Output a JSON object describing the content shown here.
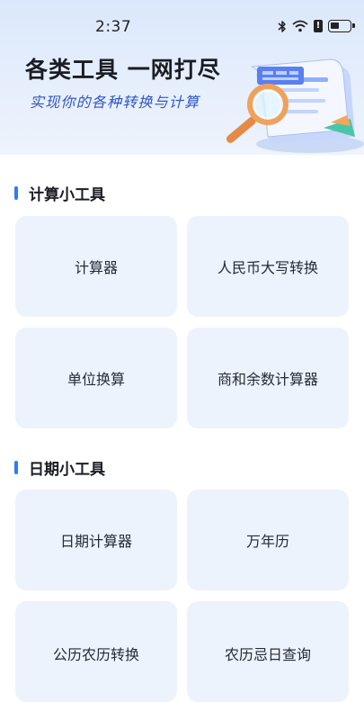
{
  "status": {
    "time": "2:37"
  },
  "hero": {
    "title": "各类工具 一网打尽",
    "subtitle": "实现你的各种转换与计算"
  },
  "sections": [
    {
      "title": "计算小工具",
      "items": [
        "计算器",
        "人民币大写转换",
        "单位换算",
        "商和余数计算器"
      ]
    },
    {
      "title": "日期小工具",
      "items": [
        "日期计算器",
        "万年历",
        "公历农历转换",
        "农历忌日查询"
      ]
    }
  ],
  "colors": {
    "accent": "#2b7cf6",
    "card_bg": "#edf3fd",
    "subtitle": "#2f56c4"
  },
  "icons": [
    "bluetooth-icon",
    "wifi-icon",
    "alert-icon",
    "battery-icon",
    "magnifier-document-illustration"
  ]
}
